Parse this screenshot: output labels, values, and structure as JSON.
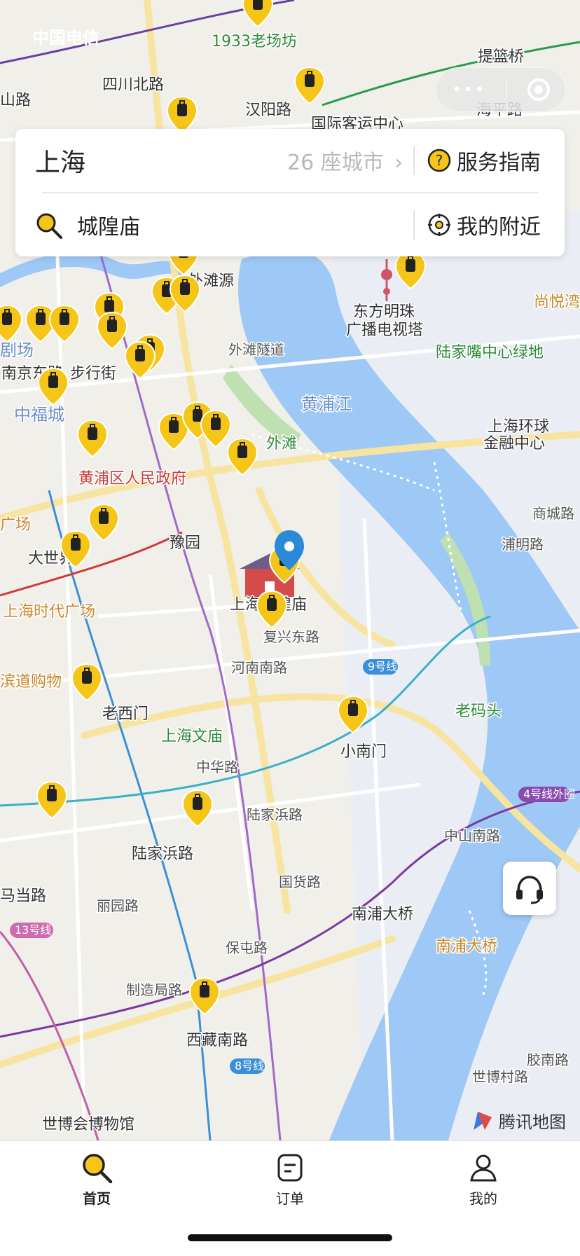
{
  "status_bar": {
    "left": "中国电信",
    "right": ""
  },
  "mini_program_capsule": {
    "more_icon": "more-dots-icon",
    "close_icon": "target-close-icon"
  },
  "search_card": {
    "city": "上海",
    "city_count": "26 座城市",
    "service_guide": "服务指南",
    "search_placeholder": "城隍庙",
    "nearby": "我的附近"
  },
  "map": {
    "labels": [
      {
        "text": "1933老场坊",
        "cls": "green"
      },
      {
        "text": "提篮桥",
        "cls": "dark"
      },
      {
        "text": "四川北路",
        "cls": "dark"
      },
      {
        "text": "山路",
        "cls": "dark"
      },
      {
        "text": "汉阳路",
        "cls": "dark"
      },
      {
        "text": "国际客运中心",
        "cls": "dark"
      },
      {
        "text": "海平路",
        "cls": "dark"
      },
      {
        "text": "外滩源",
        "cls": "dark"
      },
      {
        "text": "东方明珠",
        "cls": "dark"
      },
      {
        "text": "广播电视塔",
        "cls": "dark"
      },
      {
        "text": "尚悦湾",
        "cls": "orange"
      },
      {
        "text": "陆家嘴中心绿地",
        "cls": "green"
      },
      {
        "text": "南京东路",
        "cls": "dark"
      },
      {
        "text": "步行街",
        "cls": "dark"
      },
      {
        "text": "中福城",
        "cls": "blue"
      },
      {
        "text": "外滩",
        "cls": "green"
      },
      {
        "text": "黄浦江",
        "cls": "blue"
      },
      {
        "text": "上海环球",
        "cls": "dark"
      },
      {
        "text": "金融中心",
        "cls": "dark"
      },
      {
        "text": "黄浦区人民政府",
        "cls": "red"
      },
      {
        "text": "豫园",
        "cls": "dark"
      },
      {
        "text": "大世界",
        "cls": "dark"
      },
      {
        "text": "上海城隍庙",
        "cls": "dark"
      },
      {
        "text": "复兴东路",
        "cls": "road"
      },
      {
        "text": "上海时代广场",
        "cls": "orange"
      },
      {
        "text": "浦明路",
        "cls": "road"
      },
      {
        "text": "商城路",
        "cls": "road"
      },
      {
        "text": "老西门",
        "cls": "dark"
      },
      {
        "text": "上海文庙",
        "cls": "green"
      },
      {
        "text": "老码头",
        "cls": "green"
      },
      {
        "text": "小南门",
        "cls": "dark"
      },
      {
        "text": "中华路",
        "cls": "road"
      },
      {
        "text": "河南南路",
        "cls": "road"
      },
      {
        "text": "陆家浜路",
        "cls": "road"
      },
      {
        "text": "陆家浜路",
        "cls": "dark"
      },
      {
        "text": "中山南路",
        "cls": "road"
      },
      {
        "text": "国货路",
        "cls": "road"
      },
      {
        "text": "马当路",
        "cls": "dark"
      },
      {
        "text": "丽园路",
        "cls": "road"
      },
      {
        "text": "南浦大桥",
        "cls": "dark"
      },
      {
        "text": "南浦大桥",
        "cls": "orange"
      },
      {
        "text": "保屯路",
        "cls": "road"
      },
      {
        "text": "制造局路",
        "cls": "road"
      },
      {
        "text": "西藏南路",
        "cls": "dark"
      },
      {
        "text": "世博村路",
        "cls": "road"
      },
      {
        "text": "胶南路",
        "cls": "road"
      },
      {
        "text": "世博会博物馆",
        "cls": "dark"
      },
      {
        "text": "滨道购物",
        "cls": "orange"
      },
      {
        "text": "广场",
        "cls": "orange"
      },
      {
        "text": "剧场",
        "cls": "blue"
      },
      {
        "text": "外滩隧道",
        "cls": "road"
      },
      {
        "text": "9号线",
        "cls": "line"
      },
      {
        "text": "4号线外圈",
        "cls": "line"
      },
      {
        "text": "13号线",
        "cls": "line"
      },
      {
        "text": "8号线",
        "cls": "line"
      }
    ],
    "watermark": "腾讯地图"
  },
  "tabs": [
    {
      "label": "首页",
      "icon": "search-tab-icon",
      "active": true
    },
    {
      "label": "订单",
      "icon": "order-tab-icon",
      "active": false
    },
    {
      "label": "我的",
      "icon": "user-tab-icon",
      "active": false
    }
  ],
  "colors": {
    "accent": "#f5c518",
    "water": "#9ec8f5",
    "land": "#f2f0ec",
    "pin_blue": "#2a8ad8"
  }
}
